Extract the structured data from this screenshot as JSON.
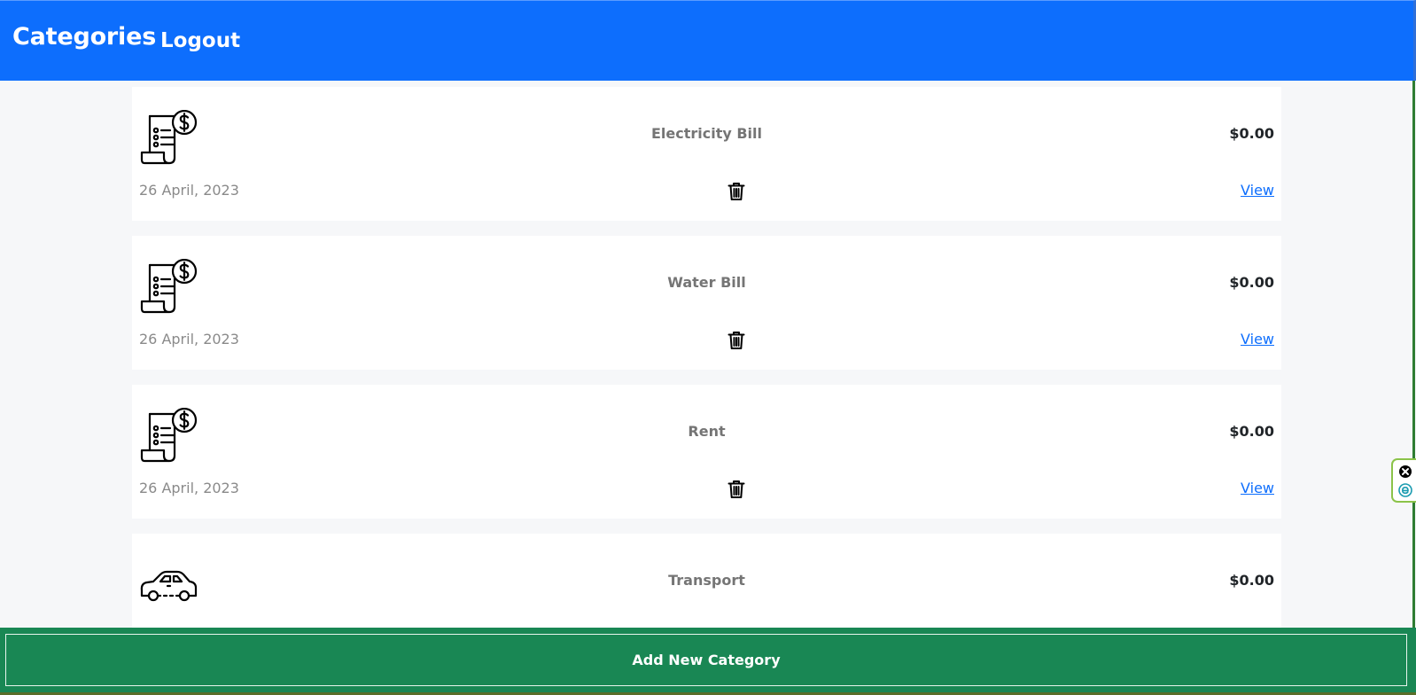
{
  "header": {
    "title": "Categories",
    "logout_label": "Logout"
  },
  "categories": [
    {
      "name": "Electricity Bill",
      "amount": "$0.00",
      "date": "26 April, 2023",
      "view_label": "View",
      "icon": "bill-icon"
    },
    {
      "name": "Water Bill",
      "amount": "$0.00",
      "date": "26 April, 2023",
      "view_label": "View",
      "icon": "bill-icon"
    },
    {
      "name": "Rent",
      "amount": "$0.00",
      "date": "26 April, 2023",
      "view_label": "View",
      "icon": "bill-icon"
    },
    {
      "name": "Transport",
      "amount": "$0.00",
      "icon": "car-icon"
    }
  ],
  "footer": {
    "add_label": "Add New Category"
  },
  "colors": {
    "header_bg": "#0d6efd",
    "footer_bg": "#198754",
    "link": "#0d6efd",
    "page_bg": "#f6f7f9"
  }
}
